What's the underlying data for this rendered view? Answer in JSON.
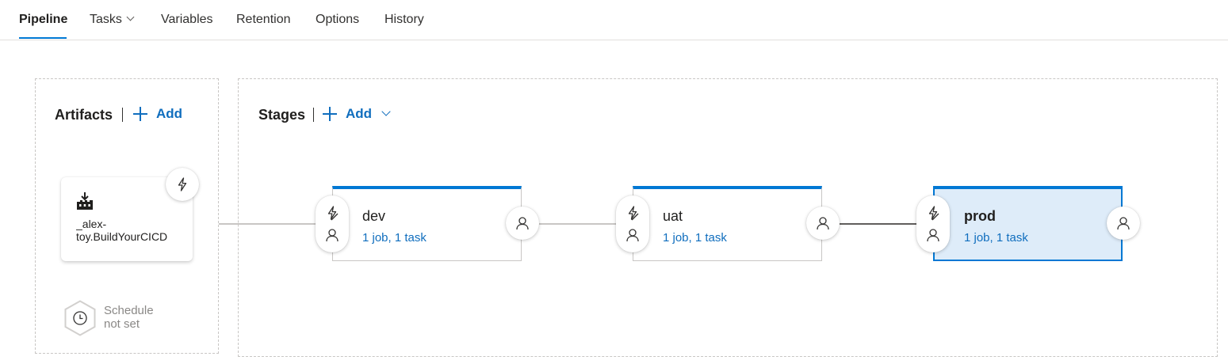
{
  "tabs": {
    "pipeline": "Pipeline",
    "tasks": "Tasks",
    "variables": "Variables",
    "retention": "Retention",
    "options": "Options",
    "history": "History"
  },
  "artifacts": {
    "title": "Artifacts",
    "add_label": "Add",
    "card": {
      "line1": "_alex-",
      "line2": "toy.BuildYourCICD"
    },
    "schedule": {
      "line1": "Schedule",
      "line2": "not set"
    }
  },
  "stages": {
    "title": "Stages",
    "add_label": "Add",
    "items": [
      {
        "name": "dev",
        "jobs": "1 job, 1 task"
      },
      {
        "name": "uat",
        "jobs": "1 job, 1 task"
      },
      {
        "name": "prod",
        "jobs": "1 job, 1 task",
        "selected": true
      }
    ]
  },
  "colors": {
    "accent": "#0078d4",
    "link": "#106ebe",
    "selected_bg": "#deecf9"
  },
  "icons": {
    "tasks_chevron": "chevron-down-icon",
    "artifact": "build-artifact-icon",
    "trigger": "lightning-icon",
    "pre_deploy_trigger": "lightning-slash-icon",
    "approver": "person-icon",
    "schedule": "clock-icon"
  }
}
